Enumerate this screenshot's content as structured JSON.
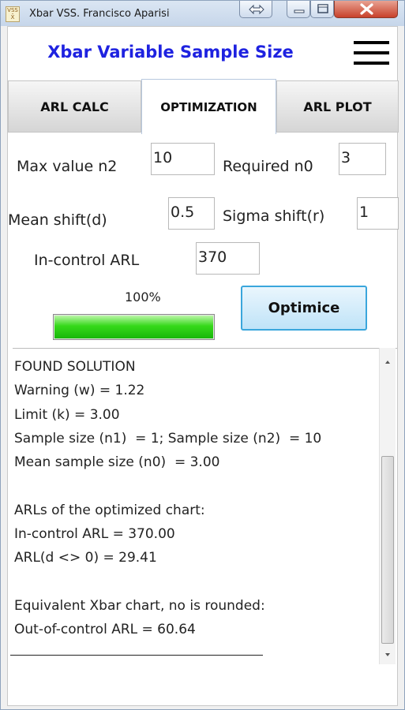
{
  "window": {
    "title": "Xbar VSS.  Francisco Aparisi",
    "icon_text": "VSS\nX",
    "controls": [
      "swap-icon",
      "minimize-icon",
      "maximize-icon",
      "close-icon"
    ]
  },
  "header": {
    "title": "Xbar Variable Sample Size",
    "menu_icon": "hamburger-menu-icon"
  },
  "tabs": [
    {
      "label": "ARL CALC",
      "active": false
    },
    {
      "label": "OPTIMIZATION",
      "active": true
    },
    {
      "label": "ARL PLOT",
      "active": false
    }
  ],
  "form": {
    "max_n2_label": "Max value n2",
    "max_n2_value": "10",
    "required_n0_label": "Required n0",
    "required_n0_value": "3",
    "mean_shift_label": "Mean shift(d)",
    "mean_shift_value": "0.5",
    "sigma_shift_label": "Sigma shift(r)",
    "sigma_shift_value": "1",
    "in_control_arl_label": "In-control ARL",
    "in_control_arl_value": "370"
  },
  "progress": {
    "label": "100%",
    "value": 1.0,
    "color": "#22c30f"
  },
  "optimize_button": {
    "label": "Optimice"
  },
  "output": {
    "lines": [
      "FOUND SOLUTION",
      "Warning (w) = 1.22",
      "Limit (k) = 3.00",
      "Sample size (n1)  = 1; Sample size (n2)  = 10",
      "Mean sample size (n0)  = 3.00",
      "",
      "ARLs of the optimized chart:",
      "In-control ARL = 370.00",
      "ARL(d <> 0) = 29.41",
      "",
      "Equivalent Xbar chart, no is rounded:",
      "Out-of-control ARL = 60.64"
    ]
  },
  "colors": {
    "title_blue": "#1e22e0",
    "button_border": "#3aa6dc"
  }
}
